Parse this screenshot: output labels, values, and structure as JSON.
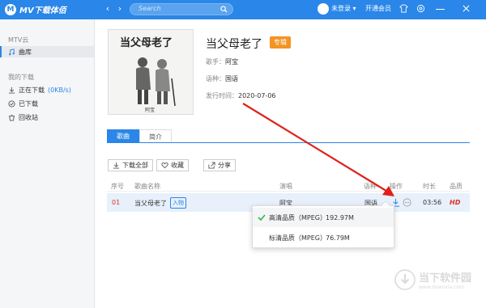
{
  "app": {
    "logo_letter": "M",
    "title": "MV下载体佰"
  },
  "search": {
    "placeholder": "Search"
  },
  "user": {
    "login_label": "未登录",
    "vip_label": "开通会员"
  },
  "sidebar": {
    "section1": "MTV云",
    "library": "曲库",
    "section2": "我的下载",
    "downloading_label": "正在下载",
    "downloading_speed": "(0KB/s)",
    "downloaded": "已下载",
    "recycle": "回收站"
  },
  "album": {
    "title": "当父母老了",
    "badge": "专辑",
    "singer_label": "歌手：",
    "singer": "阿宝",
    "language_label": "语种：",
    "language": "国语",
    "date_label": "发行时间：",
    "date": "2020-07-06",
    "cover_text": "当父母老了",
    "cover_sign": "阿宝"
  },
  "tabs": {
    "songs": "歌曲",
    "intro": "简介"
  },
  "actions": {
    "download_all": "下载全部",
    "collect": "收藏",
    "share": "分享"
  },
  "table": {
    "headers": {
      "index": "序号",
      "name": "歌曲名称",
      "singer": "演唱",
      "language": "语种",
      "ops": "操作",
      "duration": "时长",
      "quality": "品质"
    },
    "rows": [
      {
        "index": "01",
        "name": "当父母老了",
        "mv_tag": "入物",
        "singer": "阿宝",
        "language": "国语",
        "duration": "03:56",
        "quality": "HD"
      }
    ]
  },
  "popup": {
    "items": [
      {
        "quality": "高清品质（MPEG）",
        "size": "192.97M"
      },
      {
        "quality": "标清品质（MPEG）",
        "size": "76.79M"
      }
    ]
  },
  "watermark": {
    "cn": "当下软件园",
    "en": "www.downxia.com"
  },
  "colors": {
    "accent": "#2a86e8",
    "badge": "#f39423",
    "red": "#e0302a",
    "check": "#2db84d"
  }
}
